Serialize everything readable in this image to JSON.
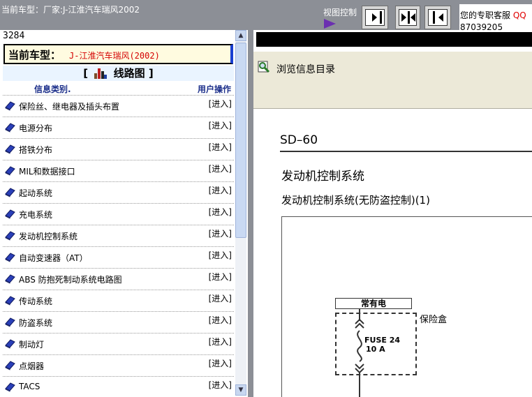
{
  "header": {
    "title": "当前车型：厂家:J-江淮汽车瑞风2002",
    "view_control_label": "视图控制",
    "service": {
      "label": "您的专职客服",
      "qq_label": "QQ",
      "number": "87039205"
    }
  },
  "left_panel": {
    "code": "3284",
    "current_model": {
      "label": "当前车型：",
      "value": "J-江淮汽车瑞风(2002)"
    },
    "section_title": "[ 线路图 ]",
    "section_title_bracket_open": "[",
    "section_title_text": "线路图",
    "section_title_bracket_close": "]",
    "columns": {
      "category": "信息类别.",
      "action": "用户操作"
    },
    "items": [
      {
        "label": "保险丝、继电器及插头布置",
        "action": "[进入]"
      },
      {
        "label": "电源分布",
        "action": "[进入]"
      },
      {
        "label": "搭铁分布",
        "action": "[进入]"
      },
      {
        "label": "MIL和数据接口",
        "action": "[进入]"
      },
      {
        "label": "起动系统",
        "action": "[进入]"
      },
      {
        "label": "充电系统",
        "action": "[进入]"
      },
      {
        "label": "发动机控制系统",
        "action": "[进入]"
      },
      {
        "label": "自动变速器（AT）",
        "action": "[进入]"
      },
      {
        "label": "ABS 防抱死制动系统电路图",
        "action": "[进入]"
      },
      {
        "label": "传动系统",
        "action": "[进入]"
      },
      {
        "label": "防盗系统",
        "action": "[进入]"
      },
      {
        "label": "制动灯",
        "action": "[进入]"
      },
      {
        "label": "点烟器",
        "action": "[进入]"
      },
      {
        "label": "TACS",
        "action": "[进入]"
      }
    ]
  },
  "right_panel": {
    "browse_label": "浏览信息目录",
    "document": {
      "page_code": "SD–60",
      "title": "发动机控制系统",
      "subtitle": "发动机控制系统(无防盗控制)(1)",
      "always_on_label": "常有电",
      "box_label": "保险盒",
      "fuse_name": "FUSE 24",
      "fuse_rating": "10 A"
    }
  },
  "colors": {
    "topbar": "#8c8f96",
    "model_value": "#d40000",
    "header_text": "#1c2f8a",
    "toolbar": "#ece9d8"
  }
}
